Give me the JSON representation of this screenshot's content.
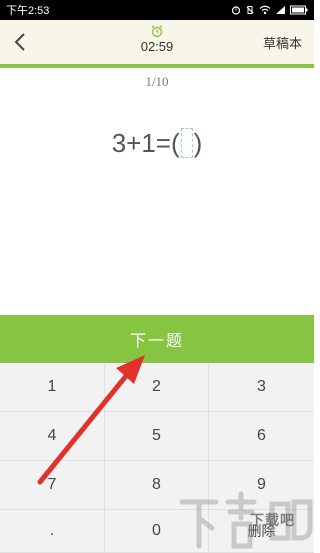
{
  "status_bar": {
    "time": "下午2:53"
  },
  "header": {
    "timer": "02:59",
    "draft_label": "草稿本"
  },
  "quiz": {
    "progress": "1/10",
    "question_left": "3+1=(",
    "question_right": ")"
  },
  "next_button": {
    "label": "下一题"
  },
  "keypad": {
    "keys": [
      "1",
      "2",
      "3",
      "4",
      "5",
      "6",
      "7",
      "8",
      "9",
      ".",
      "0",
      "删除"
    ]
  },
  "colors": {
    "accent": "#86c541",
    "annotation_arrow": "#e0312b"
  },
  "watermark": {
    "text": "下载吧"
  }
}
